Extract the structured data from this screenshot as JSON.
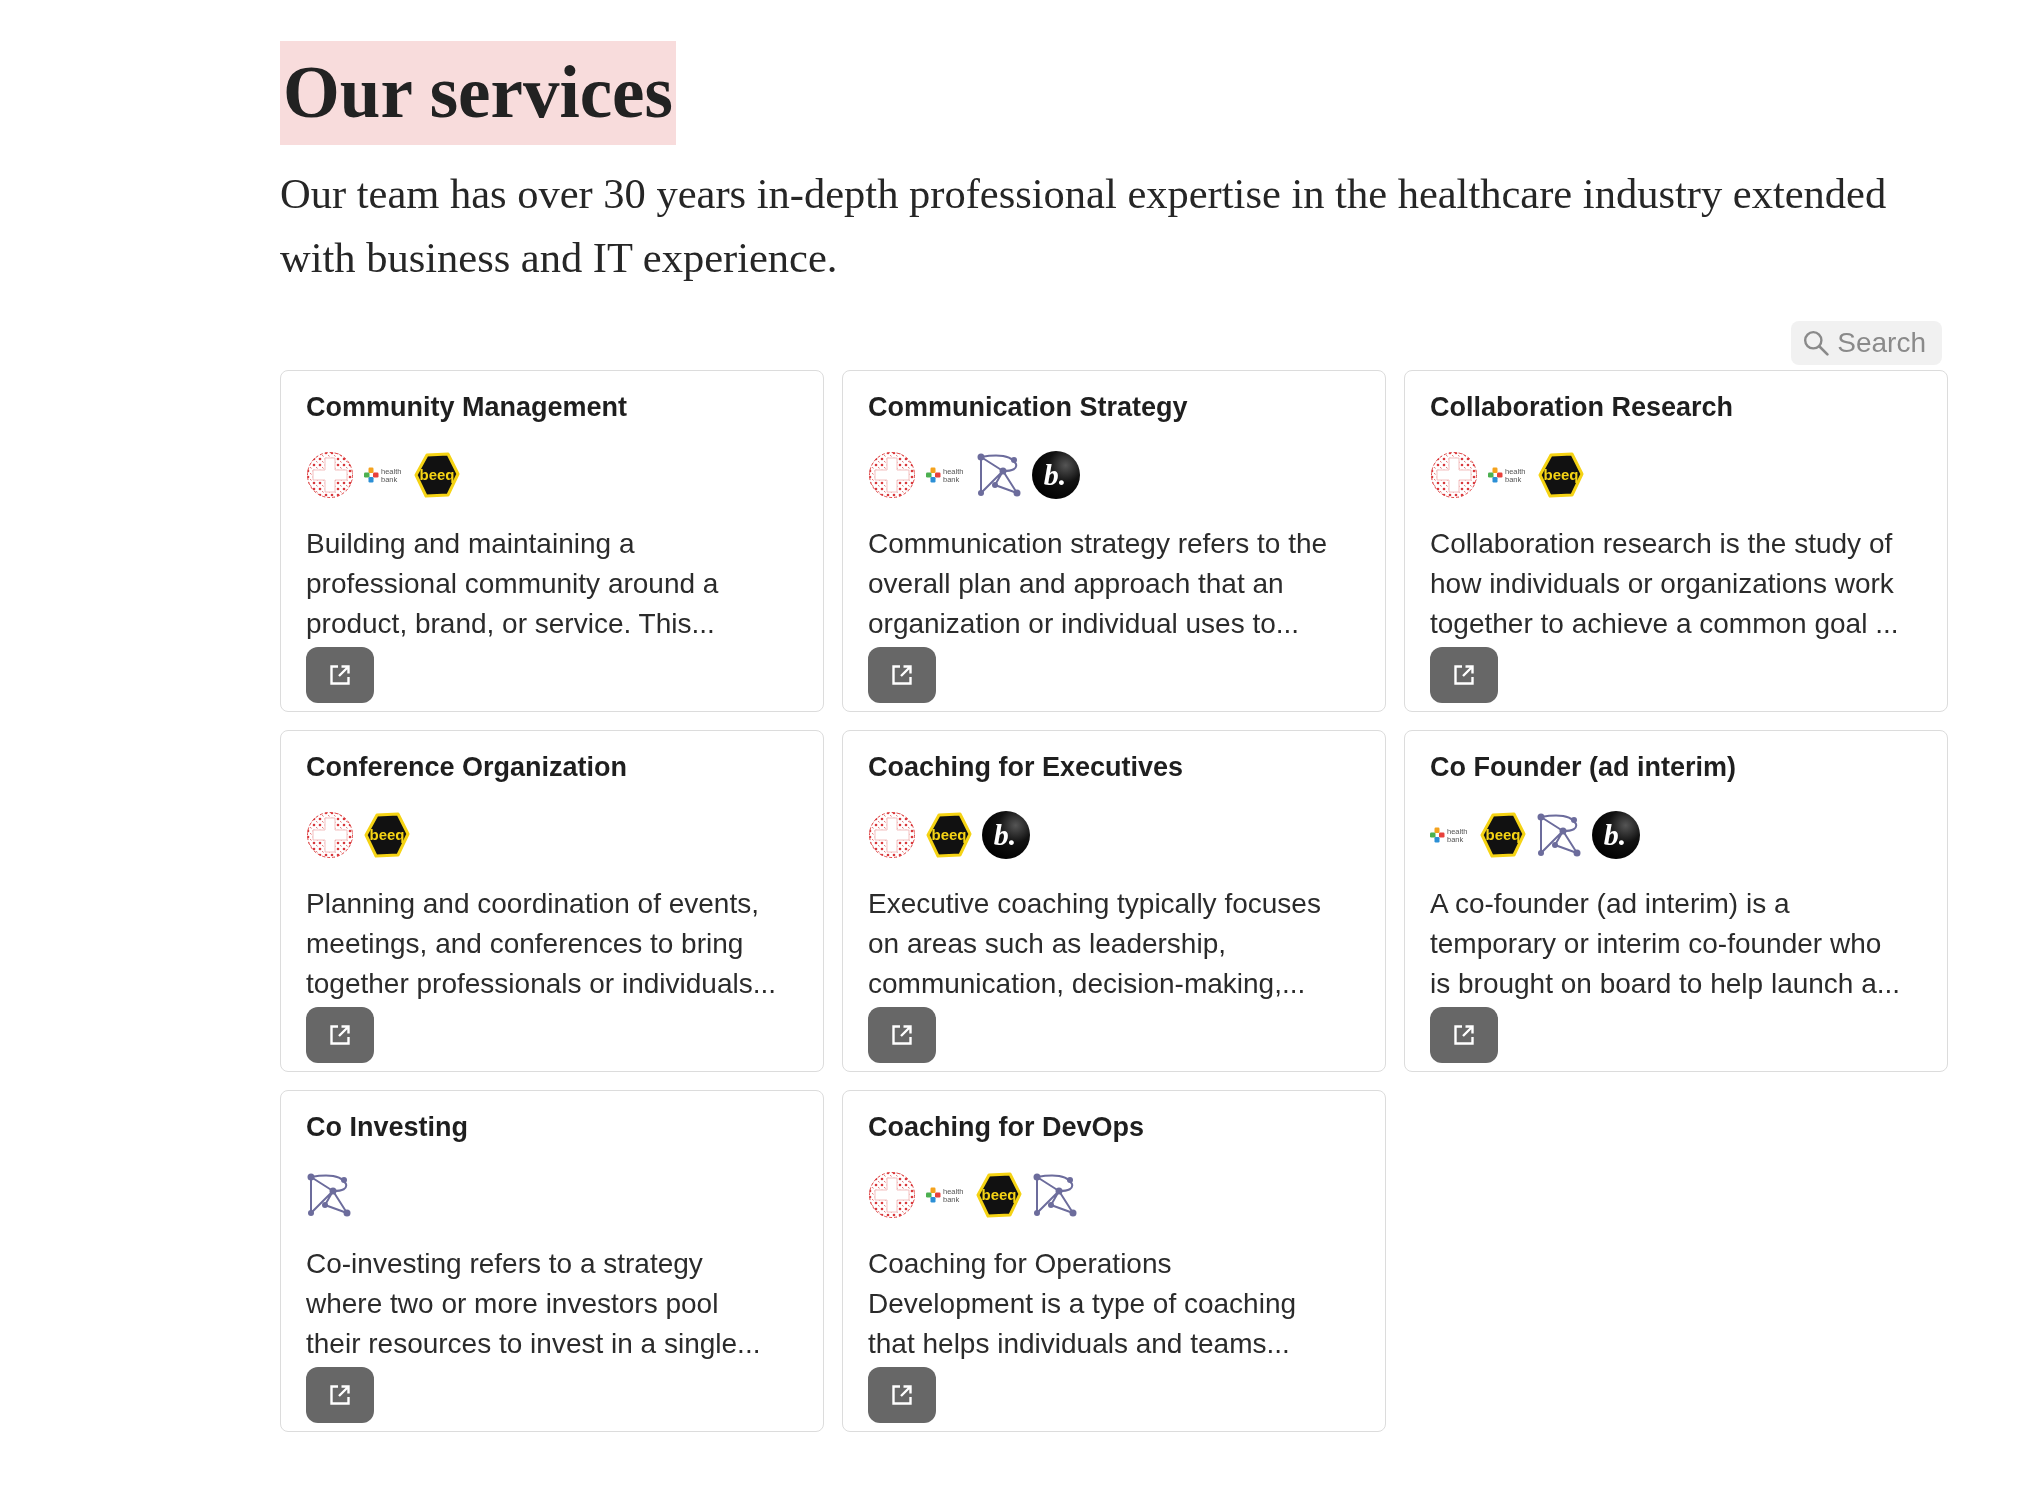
{
  "title": "Our services",
  "intro": "Our team has over 30 years in-depth professional expertise in the healthcare industry extended with business and IT experience.",
  "search": {
    "label": "Search"
  },
  "services": [
    {
      "title": "Community Management",
      "logos": [
        {
          "kind": "cross"
        },
        {
          "kind": "plus_wordmark",
          "lines": [
            "health",
            "bank"
          ]
        },
        {
          "kind": "hexagon",
          "text": "beeq"
        }
      ],
      "description": "Building and maintaining a\nprofessional community around a\nproduct, brand, or service. This..."
    },
    {
      "title": "Communication Strategy",
      "logos": [
        {
          "kind": "cross"
        },
        {
          "kind": "plus_wordmark",
          "lines": [
            "health",
            "bank"
          ]
        },
        {
          "kind": "network"
        },
        {
          "kind": "letter_circle",
          "text": "b."
        }
      ],
      "description": "Communication strategy refers to the\noverall plan and approach that an\norganization or individual uses to..."
    },
    {
      "title": "Collaboration Research",
      "logos": [
        {
          "kind": "cross"
        },
        {
          "kind": "plus_wordmark",
          "lines": [
            "health",
            "bank"
          ]
        },
        {
          "kind": "hexagon",
          "text": "beeq"
        }
      ],
      "description": "Collaboration research is the study of\nhow individuals or organizations work\ntogether to achieve a common goal ..."
    },
    {
      "title": "Conference Organization",
      "logos": [
        {
          "kind": "cross"
        },
        {
          "kind": "hexagon",
          "text": "beeq"
        }
      ],
      "description": "Planning and coordination of events,\nmeetings, and conferences to bring\ntogether professionals or individuals..."
    },
    {
      "title": "Coaching for Executives",
      "logos": [
        {
          "kind": "cross"
        },
        {
          "kind": "hexagon",
          "text": "beeq"
        },
        {
          "kind": "letter_circle",
          "text": "b."
        }
      ],
      "description": "Executive coaching typically focuses\non areas such as leadership,\ncommunication, decision-making,..."
    },
    {
      "title": "Co Founder (ad interim)",
      "logos": [
        {
          "kind": "plus_wordmark",
          "lines": [
            "health",
            "bank"
          ]
        },
        {
          "kind": "hexagon",
          "text": "beeq"
        },
        {
          "kind": "network"
        },
        {
          "kind": "letter_circle",
          "text": "b."
        }
      ],
      "description": "A co-founder (ad interim) is a\ntemporary or interim co-founder who\nis brought on board to help launch a..."
    },
    {
      "title": "Co Investing",
      "logos": [
        {
          "kind": "network"
        }
      ],
      "description": "Co-investing refers to a strategy\nwhere two or more investors pool\ntheir resources to invest in a single..."
    },
    {
      "title": "Coaching for DevOps",
      "logos": [
        {
          "kind": "cross"
        },
        {
          "kind": "plus_wordmark",
          "lines": [
            "health",
            "bank"
          ]
        },
        {
          "kind": "hexagon",
          "text": "beeq"
        },
        {
          "kind": "network"
        }
      ],
      "description": "Coaching for Operations\nDevelopment is a type of coaching\nthat helps individuals and teams..."
    }
  ]
}
